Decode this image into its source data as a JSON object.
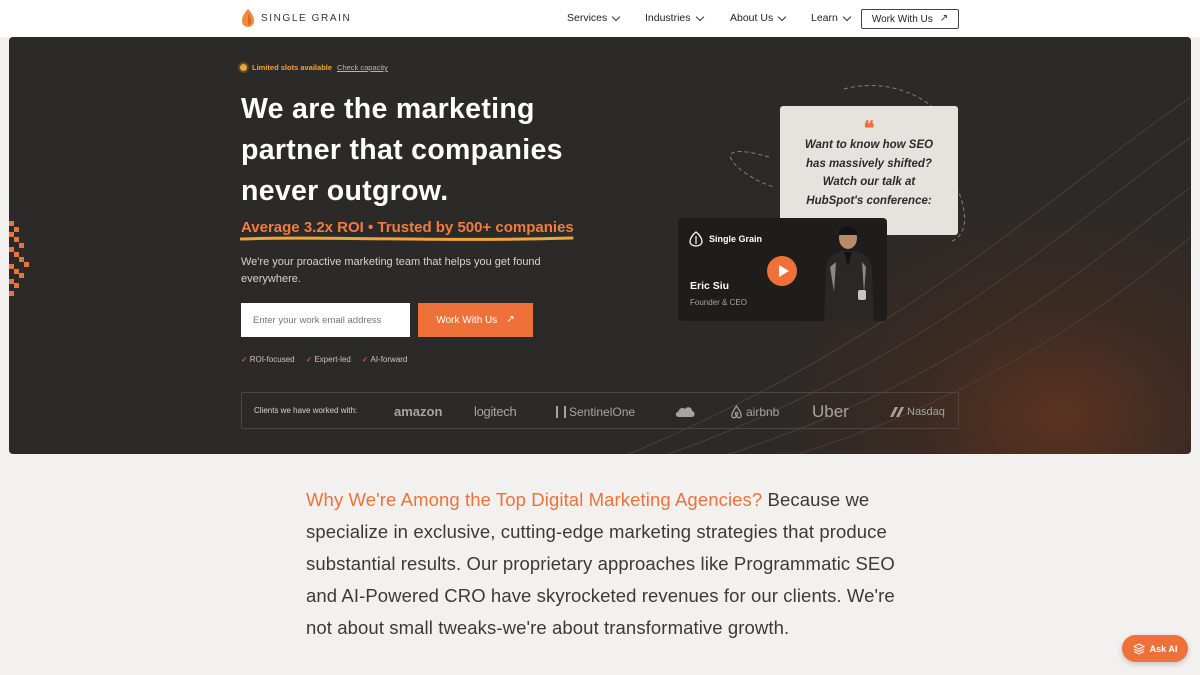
{
  "nav": {
    "logo_text": "SINGLE GRAIN",
    "items": [
      {
        "label": "Services"
      },
      {
        "label": "Industries"
      },
      {
        "label": "About Us"
      },
      {
        "label": "Learn"
      }
    ],
    "cta_label": "Work With Us",
    "cta_icon": "arrow-up-right-icon"
  },
  "hero": {
    "badge_label": "Limited slots available",
    "badge_link": "Check capacity",
    "headline": "We are the marketing partner that companies never outgrow.",
    "roi_line": "Average 3.2x ROI • Trusted by 500+ companies",
    "subtext": "We're your proactive marketing team that helps you get found everywhere.",
    "email_placeholder": "Enter your work email address",
    "cta_label": "Work With Us",
    "checks": [
      "ROI-focused",
      "Expert-led",
      "AI-forward"
    ],
    "video": {
      "quote": "Want to know how SEO has massively shifted? Watch our talk at HubSpot's conference:",
      "brand": "Single Grain",
      "name": "Eric Siu",
      "role": "Founder & CEO"
    },
    "clients_label": "Clients we have worked with:",
    "clients": [
      "amazon",
      "logitech",
      "SentinelOne",
      "salesforce",
      "airbnb",
      "Uber",
      "Nasdaq"
    ]
  },
  "body": {
    "lead": "Why We're Among the Top Digital Marketing Agencies?",
    "text": " Because we specialize in exclusive, cutting-edge marketing strategies that produce substantial results. Our proprietary approaches like Programmatic SEO and AI-Powered CRO have skyrocketed revenues for our clients. We're not about small tweaks-we're about transformative growth."
  },
  "ask_ai_label": "Ask AI",
  "colors": {
    "accent": "#ee7139",
    "hero_bg": "#2c2a29",
    "badge": "#f0a53a"
  }
}
